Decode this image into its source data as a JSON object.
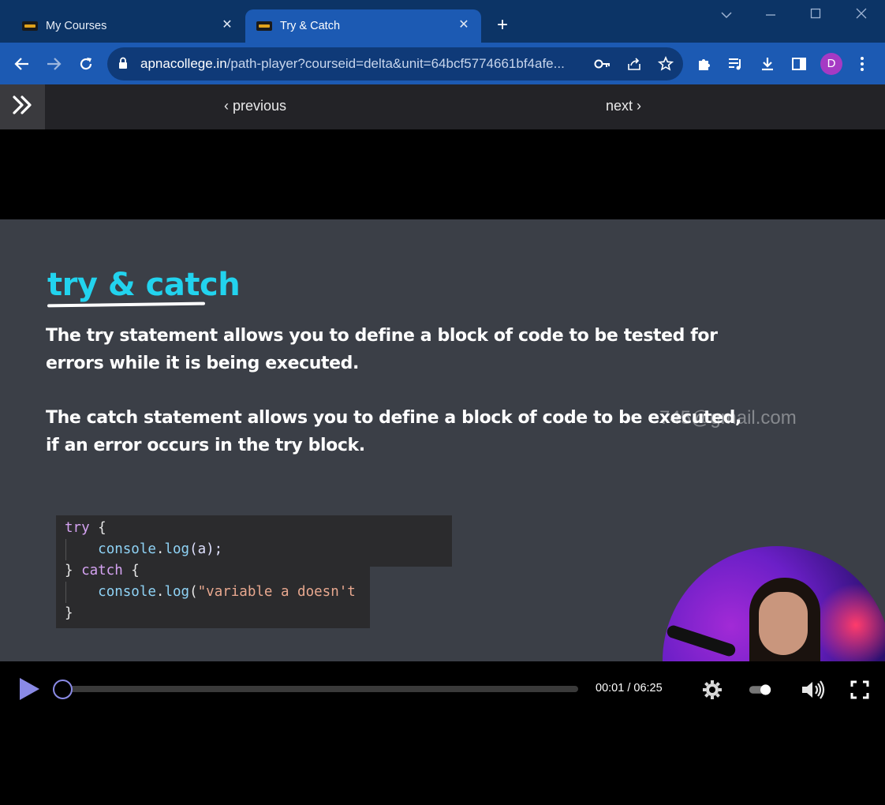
{
  "browser": {
    "tabs": [
      {
        "title": "My Courses",
        "favicon": "college-logo-icon",
        "active": false
      },
      {
        "title": "Try & Catch",
        "favicon": "college-logo-icon",
        "active": true
      }
    ],
    "url_host": "apnacollege.in",
    "url_path": "/path-player?courseid=delta&unit=64bcf5774661bf4afe...",
    "profile_initial": "D",
    "colors": {
      "tabstrip": "#0c3466",
      "toolbar": "#1c5ab3",
      "profile": "#a53ac4"
    }
  },
  "course_nav": {
    "previous_label": "previous",
    "next_label": "next",
    "expand_icon": "double-chevron-right-icon"
  },
  "slide": {
    "title": "try & catch",
    "paragraph_1": "The try statement allows you to define a block of code to be tested for errors while it is being executed.",
    "paragraph_2": "The catch statement allows you to define a block of code to be executed, if an error occurs in the try block.",
    "watermark": "745@gmail.com",
    "code": {
      "line1_kw": "try",
      "line1_rest": " {",
      "line2_fn": "console",
      "line2_dot": ".",
      "line2_call": "log",
      "line2_args": "(a);",
      "line3_open": "} ",
      "line3_kw": "catch",
      "line3_rest": " {",
      "line4_fn": "console",
      "line4_dot": ".",
      "line4_call": "log",
      "line4_paren": "(",
      "line4_str": "\"variable a doesn't",
      "line5": "}"
    },
    "colors": {
      "title": "#22d3ee",
      "background": "#3b3f47"
    }
  },
  "player": {
    "time_current": "00:01",
    "time_total": "06:25",
    "progress": 0.003,
    "accent_color": "#8a8ae6"
  }
}
